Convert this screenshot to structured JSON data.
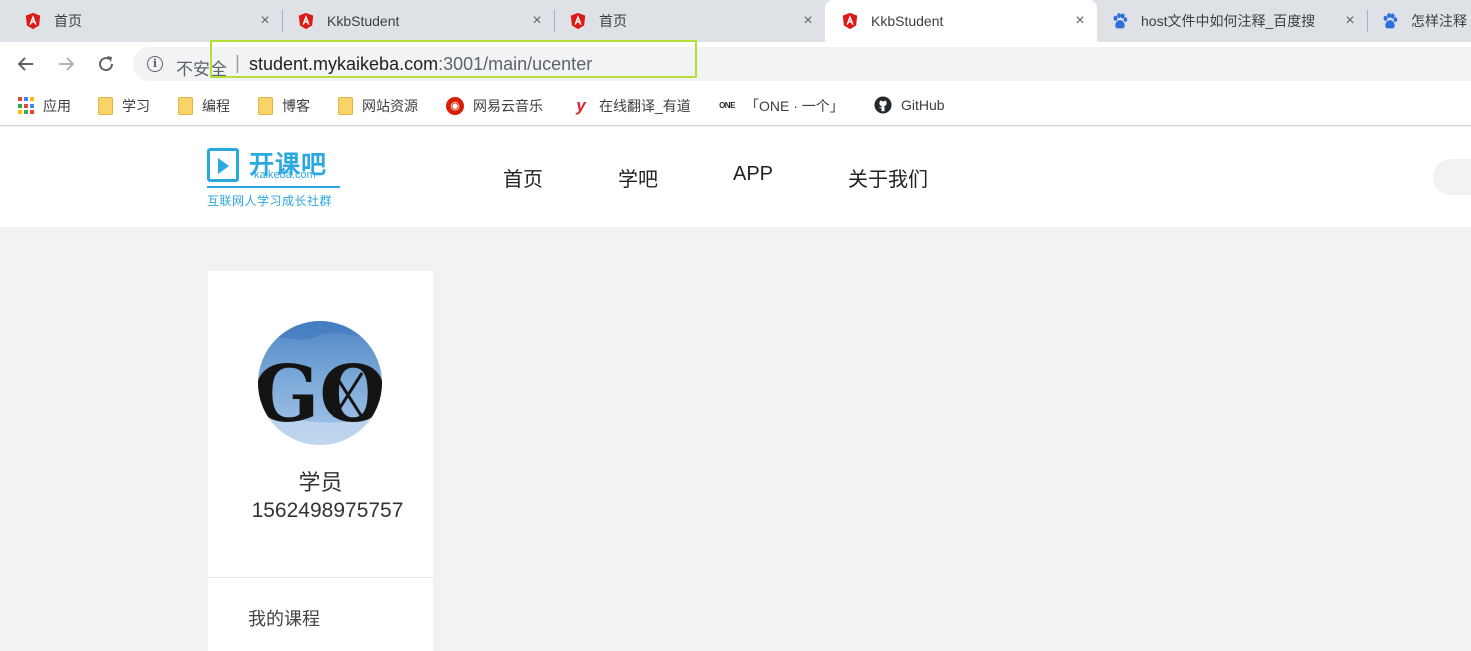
{
  "browser": {
    "tabs": [
      {
        "title": "首页",
        "icon": "angular-icon",
        "active": false
      },
      {
        "title": "KkbStudent",
        "icon": "angular-icon",
        "active": false
      },
      {
        "title": "首页",
        "icon": "angular-icon",
        "active": false
      },
      {
        "title": "KkbStudent",
        "icon": "angular-icon",
        "active": true
      },
      {
        "title": "host文件中如何注释_百度搜",
        "icon": "baidu-paw-icon",
        "active": false
      },
      {
        "title": "怎样注释",
        "icon": "baidu-paw-icon",
        "active": false
      }
    ],
    "close_glyph": "×",
    "address": {
      "security_label": "不安全",
      "separator": "|",
      "host": "student.mykaikeba.com",
      "path": ":3001/main/ucenter"
    },
    "bookmarks": [
      {
        "label": "应用",
        "icon": "apps-grid-icon"
      },
      {
        "label": "学习",
        "icon": "folder-icon"
      },
      {
        "label": "编程",
        "icon": "folder-icon"
      },
      {
        "label": "博客",
        "icon": "folder-icon"
      },
      {
        "label": "网站资源",
        "icon": "folder-icon"
      },
      {
        "label": "网易云音乐",
        "icon": "netease-music-icon"
      },
      {
        "label": "在线翻译_有道",
        "icon": "youdao-icon"
      },
      {
        "label": "「ONE · 一个」",
        "icon": "one-icon"
      },
      {
        "label": "GitHub",
        "icon": "github-icon"
      }
    ],
    "colors": {
      "tabstrip": "#dee1e6",
      "highlight": "#b5e03a"
    }
  },
  "site": {
    "logo": {
      "cn": "开课吧",
      "en": "kaikeba.com",
      "slogan": "互联网人学习成长社群",
      "color": "#2aa8e0"
    },
    "nav": [
      "首页",
      "学吧",
      "APP",
      "关于我们"
    ]
  },
  "profile": {
    "avatar_text": "GO",
    "role": "学员",
    "phone": "1562498975757",
    "menu": [
      "我的课程"
    ]
  }
}
